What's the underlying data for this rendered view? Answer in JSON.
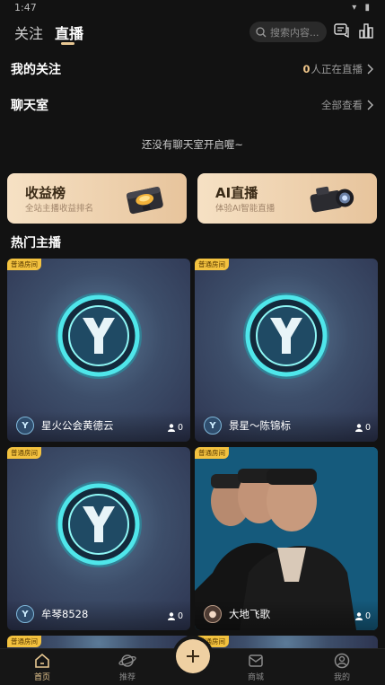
{
  "status_bar": {
    "time": "1:47",
    "icons": [
      "wifi-icon",
      "battery-icon"
    ]
  },
  "header": {
    "tabs": [
      {
        "label": "关注",
        "active": false
      },
      {
        "label": "直播",
        "active": true
      }
    ],
    "search_placeholder": "搜索内容..."
  },
  "my_follow": {
    "title": "我的关注",
    "count": "0",
    "count_suffix": "人正在直播"
  },
  "chat_room": {
    "title": "聊天室",
    "view_all": "全部查看",
    "empty_text": "还没有聊天室开启喔~"
  },
  "banners": [
    {
      "title": "收益榜",
      "subtitle": "全站主播收益排名",
      "icon": "treasure-chest-icon"
    },
    {
      "title": "AI直播",
      "subtitle": "体验AI智能直播",
      "icon": "camera-icon"
    }
  ],
  "hot_title": "热门主播",
  "cards": [
    {
      "badge": "普通房间",
      "name": "星火公会黄德云",
      "viewers": "0",
      "thumbnail": "y-logo"
    },
    {
      "badge": "普通房间",
      "name": "景星～陈锦标",
      "viewers": "0",
      "thumbnail": "y-logo"
    },
    {
      "badge": "普通房间",
      "name": "牟琴8528",
      "viewers": "0",
      "thumbnail": "y-logo"
    },
    {
      "badge": "普通房间",
      "name": "大地飞歌",
      "viewers": "0",
      "thumbnail": "photo"
    },
    {
      "badge": "普通房间"
    },
    {
      "badge": "普通房间"
    }
  ],
  "tab_bar": [
    {
      "label": "首页",
      "icon": "home-icon",
      "active": true
    },
    {
      "label": "推荐",
      "icon": "planet-icon",
      "active": false
    },
    {
      "label": "",
      "icon": "plus-icon",
      "active": false
    },
    {
      "label": "商城",
      "icon": "mail-icon",
      "active": false
    },
    {
      "label": "我的",
      "icon": "user-icon",
      "active": false
    }
  ],
  "colors": {
    "accent": "#e8c793",
    "background": "#121212",
    "badge": "#f3c23f"
  }
}
